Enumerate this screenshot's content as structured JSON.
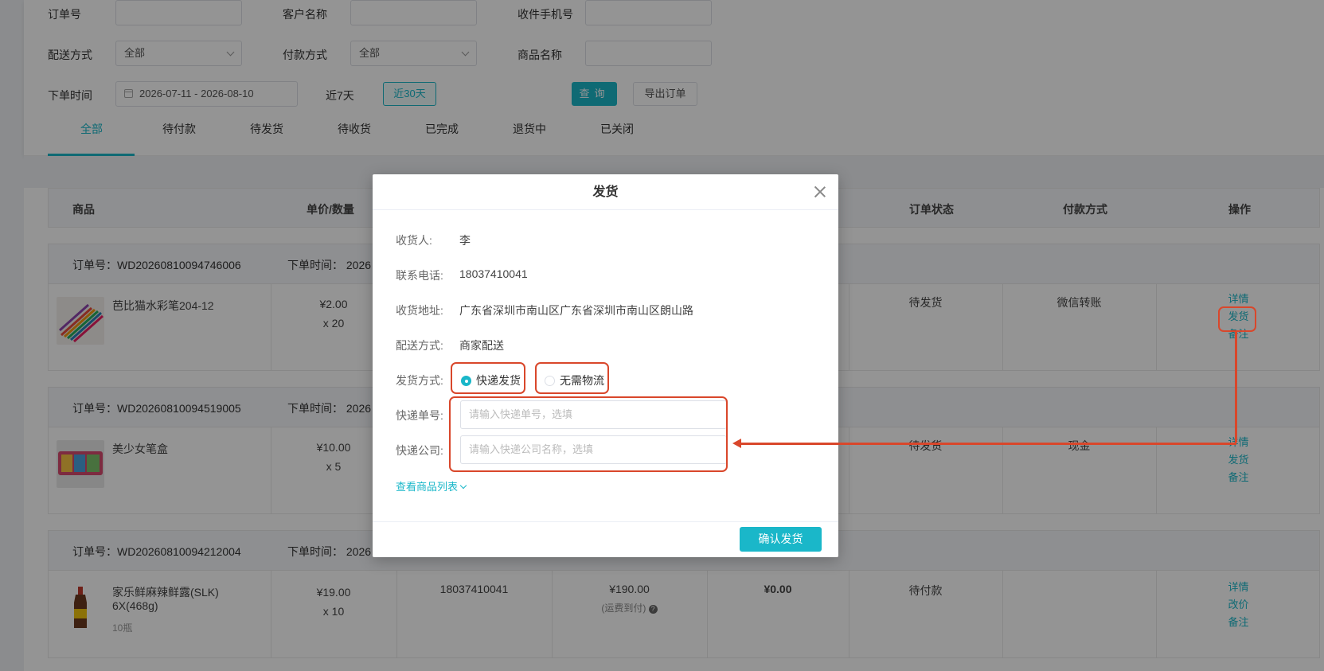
{
  "filters": {
    "order_no_label": "订单号",
    "customer_label": "客户名称",
    "phone_label": "收件手机号",
    "delivery_label": "配送方式",
    "delivery_value": "全部",
    "payment_label": "付款方式",
    "payment_value": "全部",
    "product_label": "商品名称",
    "time_label": "下单时间",
    "date_range": "2026-07-11  -  2026-08-10",
    "quick_7": "近7天",
    "quick_30": "近30天",
    "query_btn": "查询",
    "export_btn": "导出订单"
  },
  "tabs": [
    "全部",
    "待付款",
    "待发货",
    "待收货",
    "已完成",
    "退货中",
    "已关闭"
  ],
  "table_headers": {
    "product": "商品",
    "price_qty": "单价/数量",
    "status": "订单状态",
    "payment": "付款方式",
    "ops": "操作"
  },
  "orders": [
    {
      "order_no": "订单号：WD20260810094746006",
      "time": "下单时间： 2026",
      "product": "芭比猫水彩笔204-12",
      "price": "¥2.00",
      "qty": "x 20",
      "status": "待发货",
      "payment": "微信转账",
      "ops": [
        "详情",
        "发货",
        "备注"
      ]
    },
    {
      "order_no": "订单号：WD20260810094519005",
      "time": "下单时间： 2026",
      "product": "美少女笔盒",
      "price": "¥10.00",
      "qty": "x 5",
      "status": "待发货",
      "payment": "现金",
      "ops": [
        "详情",
        "发货",
        "备注"
      ]
    },
    {
      "order_no": "订单号：WD20260810094212004",
      "time": "下单时间： 2026",
      "product": "家乐鲜麻辣鲜露(SLK)",
      "product_line2": "6X(468g)",
      "product_sub": "10瓶",
      "price": "¥19.00",
      "qty": "x 10",
      "phone": "18037410041",
      "total": "¥190.00",
      "total_note": "(运费到付)",
      "paid": "¥0.00",
      "status": "待付款",
      "payment": "",
      "ops": [
        "详情",
        "改价",
        "备注"
      ]
    }
  ],
  "modal": {
    "title": "发货",
    "receiver_label": "收货人:",
    "receiver_value": "李",
    "phone_label": "联系电话:",
    "phone_value": "18037410041",
    "address_label": "收货地址:",
    "address_value": "广东省深圳市南山区广东省深圳市南山区朗山路",
    "delivery_label": "配送方式:",
    "delivery_value": "商家配送",
    "ship_method_label": "发货方式:",
    "ship_express": "快递发货",
    "ship_none": "无需物流",
    "tracking_label": "快递单号:",
    "tracking_placeholder": "请输入快递单号，选填",
    "company_label": "快递公司:",
    "company_placeholder": "请输入快递公司名称，选填",
    "view_products": "查看商品列表",
    "confirm_btn": "确认发货"
  },
  "colors": {
    "accent": "#1ab7c9",
    "annotation": "#d9472b"
  }
}
